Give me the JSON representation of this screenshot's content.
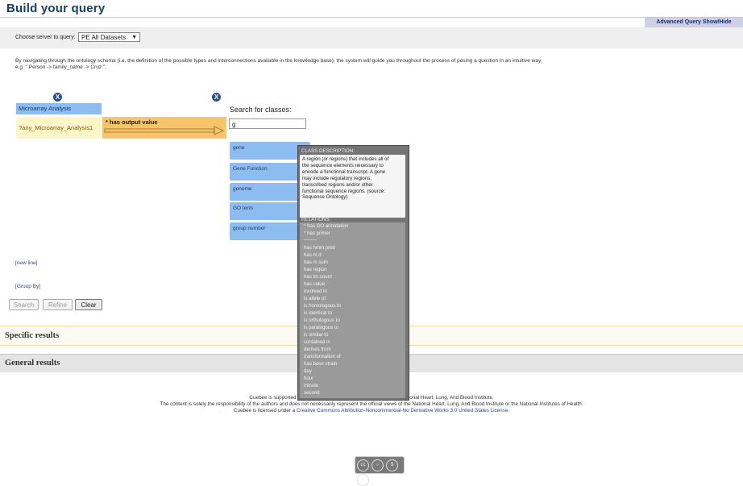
{
  "header": {
    "title": "Build your query",
    "advanced_button": "Advanced Query Show/Hide"
  },
  "server": {
    "label": "Choose server to query:",
    "selected": "PE All Datasets"
  },
  "intro": {
    "line1": "By navigating through the ontology schema (i.e. the definition of the possible types and interconnections available in the knowledge base), the system will guide you throughout the process of posing a question in an intuitive way,",
    "line2": "e.g. \" Person -> family_name -> Cruz \"."
  },
  "query": {
    "remove_icon_1": "X",
    "remove_icon_2": "X",
    "concept_label": "Microarray Analysis",
    "concept_variable": "?any_Microarray_Analysis1",
    "property_label": "* has output value"
  },
  "search": {
    "label": "Search for classes:",
    "value": "g"
  },
  "classes": [
    "gene",
    "Gene Function",
    "genome",
    "GO term",
    "group number"
  ],
  "tooltip": {
    "desc_title": "CLASS DESCRIPTION:",
    "description": [
      "A region (or regions) that includes all of",
      "the sequence elements necessary to",
      "encode a functional transcript. A gene",
      "may include regulatory regions,",
      "transcribed regions and/or other",
      "functional sequence regions. (source:",
      "Sequence Ontology)"
    ],
    "relations_title": "RELATIONS:",
    "relations": [
      "* has GO annotation",
      "* has primer",
      "--------",
      "has hmm prob",
      "has m d",
      "has m sum",
      "has region",
      "has tm count",
      "has value",
      "involved in",
      "is allele of",
      "is homologous to",
      "is identical to",
      "is orthologous to",
      "is paralogous to",
      "is similar to",
      "contained in",
      "derives from",
      "transformation of",
      "has base strain",
      "day",
      "hour",
      "minute",
      "second"
    ]
  },
  "links": {
    "new_line": "[new line]",
    "group_by": "[Group By]"
  },
  "buttons": {
    "search": "Search",
    "refine": "Refine",
    "clear": "Clear"
  },
  "results": {
    "specific": "Specific results",
    "general": "General results"
  },
  "footer": {
    "line1_a": "Cuebee is supported",
    "line1_b": "National Heart, Lung, And Blood Institute.",
    "line2_a": "The content is solely the responsibility of the authors and does not necessarily represent the official views of the National Heart, Lung, And Blood Institute or the National Institutes of Health.",
    "line3_a": "Cuebee is licensed under a ",
    "line3_link": "Creative Commons Attribution-Noncommercial-No Derivative Works 3.0 United States License."
  },
  "colors": {
    "title": "#163f68",
    "concept_blue": "#8cbcf0",
    "property_orange": "#f7c46a",
    "variable_yellow": "#fdf6c8",
    "tooltip_gray": "#696969"
  }
}
